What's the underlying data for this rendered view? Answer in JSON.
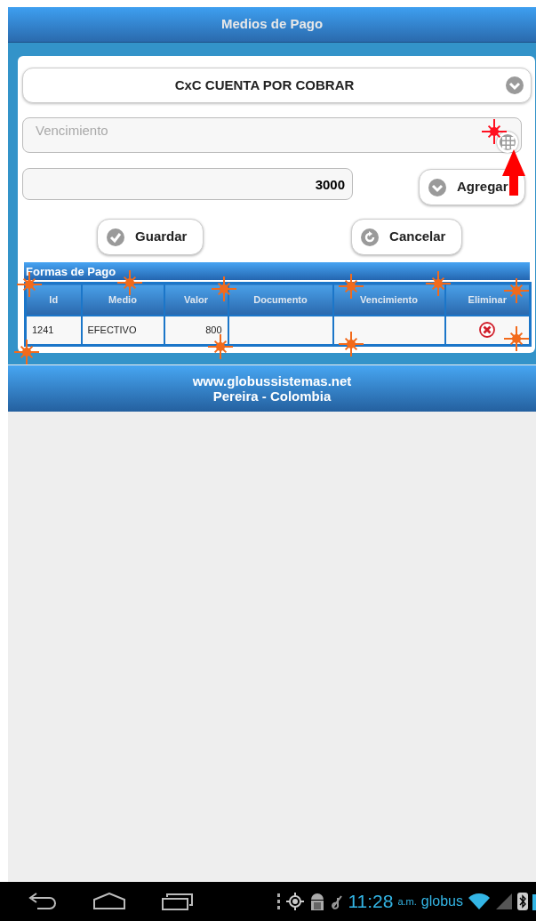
{
  "header": {
    "title": "Medios de Pago"
  },
  "form": {
    "payment_method": {
      "value": "CxC CUENTA POR COBRAR"
    },
    "due_date": {
      "placeholder": "Vencimiento"
    },
    "amount": {
      "value": "3000"
    },
    "add_button": {
      "label": "Agregar"
    },
    "actions": [
      {
        "label": "Guardar",
        "kind": "check"
      },
      {
        "label": "Cancelar",
        "kind": "refresh"
      }
    ]
  },
  "table": {
    "title": "Formas de Pago",
    "columns": [
      "Id",
      "Medio",
      "Valor",
      "Documento",
      "Vencimiento",
      "Eliminar"
    ],
    "rows": [
      {
        "id": "1241",
        "medio": "EFECTIVO",
        "valor": "800"
      }
    ]
  },
  "footer": {
    "lines": [
      "www.globussistemas.net",
      "Pereira - Colombia"
    ]
  },
  "system_bar": {
    "time": "11:28",
    "period": "a.m.",
    "carrier": "globus"
  }
}
